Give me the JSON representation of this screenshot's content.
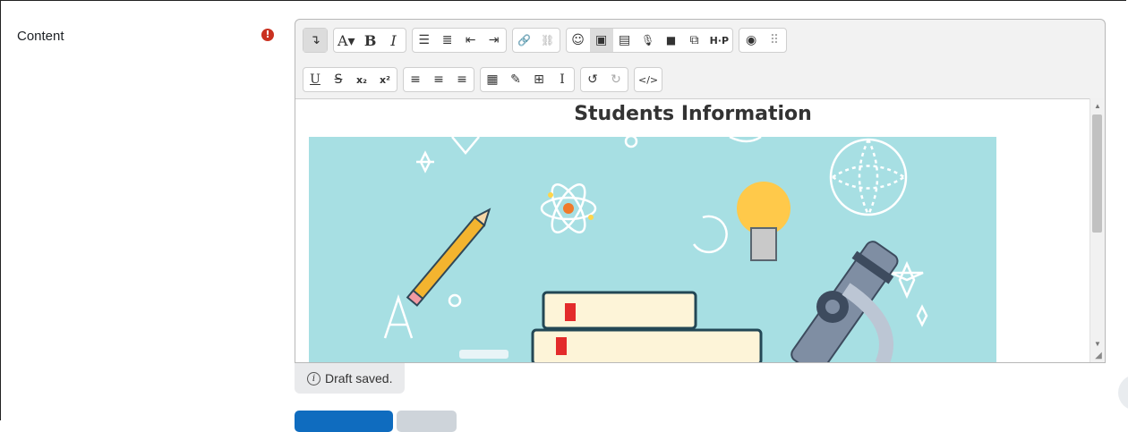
{
  "form": {
    "field_label": "Content",
    "required_icon": "!"
  },
  "editor": {
    "toolbar_row1": [
      {
        "name": "show-more-buttons-icon",
        "glyph": "↴"
      },
      {
        "name": "font-style-button",
        "glyph": "A▾"
      },
      {
        "name": "bold-button",
        "glyph": "B"
      },
      {
        "name": "italic-button",
        "glyph": "I"
      },
      {
        "name": "unordered-list-icon",
        "glyph": "☰"
      },
      {
        "name": "ordered-list-icon",
        "glyph": "≣"
      },
      {
        "name": "outdent-icon",
        "glyph": "⇤"
      },
      {
        "name": "indent-icon",
        "glyph": "⇥"
      },
      {
        "name": "link-icon",
        "glyph": "🔗"
      },
      {
        "name": "unlink-icon",
        "glyph": "⛓"
      },
      {
        "name": "emoji-icon",
        "glyph": "☺"
      },
      {
        "name": "image-icon",
        "glyph": "▣"
      },
      {
        "name": "media-file-icon",
        "glyph": "▤"
      },
      {
        "name": "microphone-icon",
        "glyph": "🎙"
      },
      {
        "name": "video-camera-icon",
        "glyph": "■"
      },
      {
        "name": "copy-icon",
        "glyph": "⧉"
      },
      {
        "name": "h5p-icon",
        "glyph": "H·P"
      },
      {
        "name": "accessibility-checker-icon",
        "glyph": "◉"
      },
      {
        "name": "screenreader-helper-icon",
        "glyph": "⠿"
      }
    ],
    "toolbar_row2": [
      {
        "name": "underline-icon",
        "glyph": "U"
      },
      {
        "name": "strikethrough-icon",
        "glyph": "S"
      },
      {
        "name": "subscript-icon",
        "glyph": "x₂"
      },
      {
        "name": "superscript-icon",
        "glyph": "x²"
      },
      {
        "name": "align-left-icon",
        "glyph": "≡"
      },
      {
        "name": "align-center-icon",
        "glyph": "≡"
      },
      {
        "name": "align-right-icon",
        "glyph": "≡"
      },
      {
        "name": "equation-editor-icon",
        "glyph": "▦"
      },
      {
        "name": "edit-icon",
        "glyph": "✎"
      },
      {
        "name": "table-icon",
        "glyph": "⊞"
      },
      {
        "name": "clear-formatting-icon",
        "glyph": "I"
      },
      {
        "name": "undo-icon",
        "glyph": "↺"
      },
      {
        "name": "redo-icon",
        "glyph": "↻"
      },
      {
        "name": "html-icon",
        "glyph": "</>"
      }
    ],
    "content_heading": "Students Information",
    "scroll_up": "▲",
    "scroll_down": "▼",
    "resize_grip": "◢",
    "status_info_icon": "i",
    "status_text": "Draft saved."
  },
  "colors": {
    "primary": "#0f6cbf",
    "secondary": "#ced4da",
    "required": "#ca3120",
    "image_background": "#a7dfe3"
  }
}
